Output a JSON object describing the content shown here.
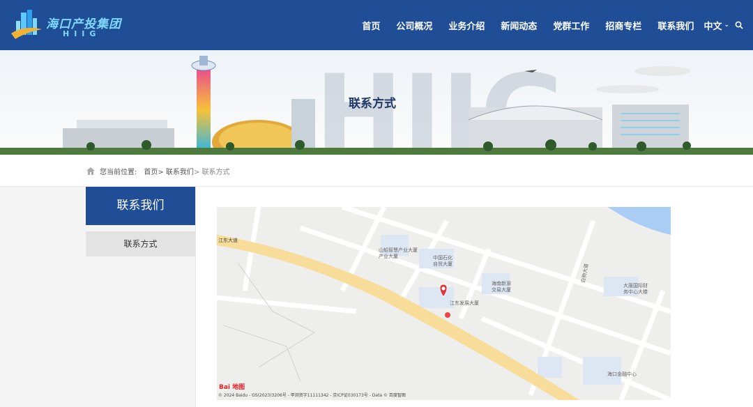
{
  "header": {
    "logo_text": "海口产投集团",
    "logo_sub": "HIIG",
    "nav": [
      "首页",
      "公司概况",
      "业务介绍",
      "新闻动态",
      "党群工作",
      "招商专栏",
      "联系我们"
    ],
    "lang": "中文"
  },
  "banner": {
    "title": "联系方式",
    "watermark": "HIIG"
  },
  "breadcrumb": {
    "label": "您当前位置:",
    "items": [
      "首页",
      "> 联系我们",
      "> 联系方式"
    ]
  },
  "sidebar": {
    "heading": "联系我们",
    "items": [
      "联系方式"
    ]
  },
  "map": {
    "labels": {
      "road_a": "江东大道",
      "road_b": "白驹大道",
      "poi1": "山船智慧产业大厦",
      "poi1b": "产业大厦",
      "poi2": "中国石化",
      "poi2b": "自贸大厦",
      "poi3": "海南新源",
      "poi3b": "交易大厦",
      "poi4": "大唐国际财",
      "poi4b": "务中心大楼",
      "marker": "江东发展大厦",
      "poi5": "海口金融中心"
    },
    "logo": "Bai 地图",
    "copyright": "© 2024 Baidu - GS(2023)3206号 - 甲测资字11111342 - 京ICP证030173号 - Data © 百度智图"
  },
  "colors": {
    "brand_blue": "#1f4e97",
    "road": "#f8dd9a",
    "water": "#a9cdf5"
  }
}
